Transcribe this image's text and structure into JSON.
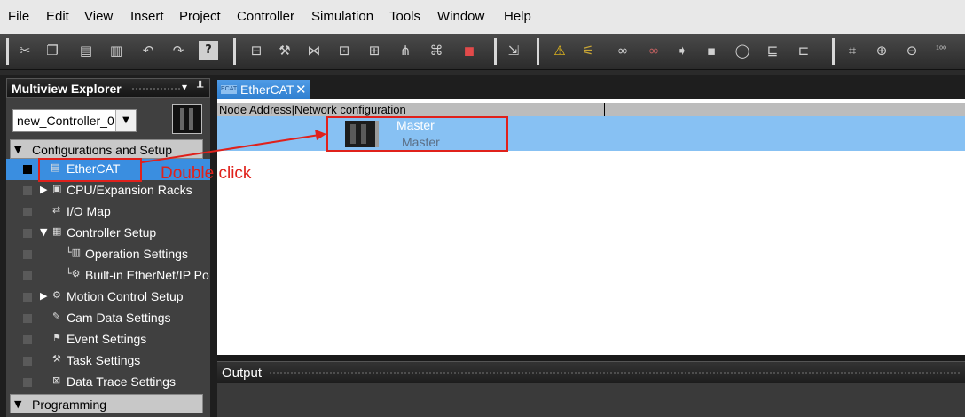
{
  "menu": [
    "File",
    "Edit",
    "View",
    "Insert",
    "Project",
    "Controller",
    "Simulation",
    "Tools",
    "Window",
    "Help"
  ],
  "toolbar": {
    "icons": [
      "cut-icon",
      "copy-icon",
      "paste-icon",
      "delete-icon",
      "undo-icon",
      "redo-icon",
      "help-icon",
      "layout-icon",
      "build-icon",
      "compare-icon",
      "cross-reference-icon",
      "watch-icon",
      "tasks-icon",
      "find-icon",
      "stop-icon",
      "build-controller-icon",
      "warning-icon",
      "online-icon",
      "link-icon",
      "unlink-icon",
      "transfer-to-icon",
      "transfer-from-icon",
      "reset-icon",
      "controller-icon",
      "network-icon",
      "fit-icon",
      "zoom-in-icon",
      "zoom-out-icon",
      "zoom-100-icon"
    ]
  },
  "explorer": {
    "title": "Multiview Explorer",
    "pin_glyphs": [
      "▾",
      "╨"
    ],
    "controller_select": {
      "value": "new_Controller_0",
      "arrow": "▼"
    },
    "config_section": {
      "label": "Configurations and Setup",
      "toggle": "▼"
    },
    "programming_section": {
      "label": "Programming",
      "toggle": "▼"
    },
    "items": [
      {
        "label": "EtherCAT",
        "icon": "ethercat-icon",
        "glyph": "▤",
        "selected": true
      },
      {
        "label": "CPU/Expansion Racks",
        "icon": "rack-icon",
        "glyph": "▣",
        "arrow": "▶"
      },
      {
        "label": "I/O Map",
        "icon": "io-map-icon",
        "glyph": "⇄"
      },
      {
        "label": "Controller Setup",
        "icon": "controller-setup-icon",
        "glyph": "▦",
        "arrow": "▼"
      },
      {
        "label": "Operation Settings",
        "icon": "operation-settings-icon",
        "glyph": "└▥"
      },
      {
        "label": "Built-in EtherNet/IP Po",
        "icon": "ethernet-icon",
        "glyph": "└⚙"
      },
      {
        "label": "Motion Control Setup",
        "icon": "motion-icon",
        "glyph": "⚙",
        "arrow": "▶"
      },
      {
        "label": "Cam Data Settings",
        "icon": "cam-icon",
        "glyph": "✎"
      },
      {
        "label": "Event Settings",
        "icon": "event-icon",
        "glyph": "⚑"
      },
      {
        "label": "Task Settings",
        "icon": "task-icon",
        "glyph": "⚒"
      },
      {
        "label": "Data Trace Settings",
        "icon": "trace-icon",
        "glyph": "⊠"
      }
    ]
  },
  "tab": {
    "label": "EtherCAT",
    "close": "✕",
    "icon_text": "ECAT"
  },
  "ethercat": {
    "header": "Node Address|Network configuration",
    "master_name": "Master",
    "master_type": "Master"
  },
  "output": {
    "title": "Output"
  },
  "annotation": {
    "text": "Double click",
    "color": "#e0211b"
  },
  "colors": {
    "selection": "#3a8ee0",
    "master_row": "#87c1f3",
    "tab": "#2f7fd0"
  }
}
